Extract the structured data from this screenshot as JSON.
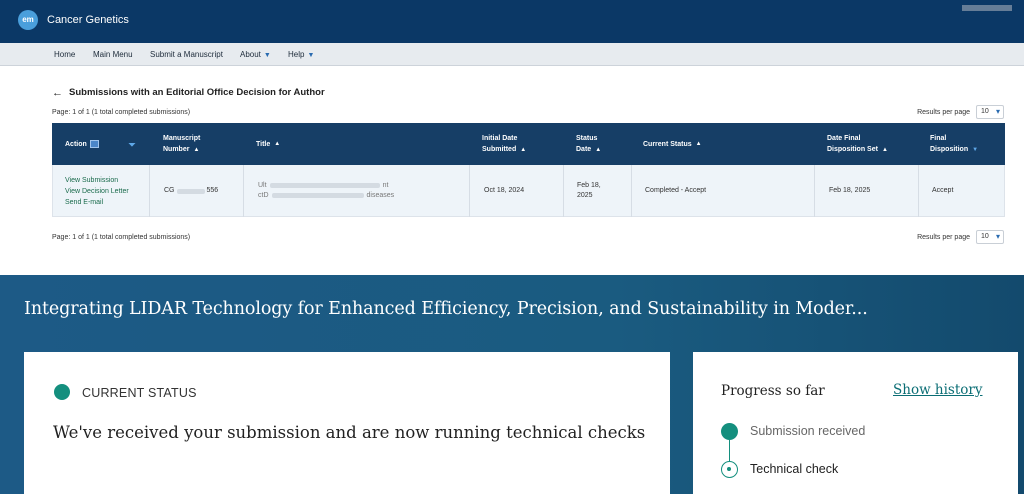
{
  "editorial_manager": {
    "logo_text": "em",
    "journal_name": "Cancer Genetics",
    "nav": [
      {
        "label": "Home",
        "dropdown": false
      },
      {
        "label": "Main Menu",
        "dropdown": false
      },
      {
        "label": "Submit a Manuscript",
        "dropdown": false
      },
      {
        "label": "About",
        "dropdown": true
      },
      {
        "label": "Help",
        "dropdown": true
      }
    ],
    "page_title": "Submissions with an Editorial Office Decision for Author",
    "paging_text": "Page: 1 of 1 (1 total completed submissions)",
    "results_per_page_label": "Results per page",
    "results_per_page_value": "10",
    "columns": {
      "action": "Action",
      "manuscript_number": [
        "Manuscript",
        "Number"
      ],
      "title": "Title",
      "initial_date": [
        "Initial Date",
        "Submitted"
      ],
      "status_date": [
        "Status",
        "Date"
      ],
      "current_status": "Current Status",
      "final_disposition_date": [
        "Date Final",
        "Disposition Set"
      ],
      "final_disposition": [
        "Final",
        "Disposition"
      ]
    },
    "row": {
      "actions": [
        "View Submission",
        "View Decision Letter",
        "Send E-mail"
      ],
      "manuscript_prefix": "CG",
      "manuscript_suffix": "556",
      "title_line1_start": "Ult",
      "title_line1_end": "nt",
      "title_line2_start": "ctD",
      "title_line2_end": "diseases",
      "initial_date": "Oct 18, 2024",
      "status_date": [
        "Feb 18,",
        "2025"
      ],
      "current_status": "Completed - Accept",
      "final_disposition_date": "Feb 18, 2025",
      "final_disposition": "Accept"
    },
    "accent_color": "#0b3866"
  },
  "springer_tracker": {
    "manuscript_title": "Integrating LIDAR Technology for Enhanced Efficiency, Precision, and Sustainability in Moder...",
    "status_label": "CURRENT STATUS",
    "status_message": "We've received your submission and are now running technical checks",
    "progress_title": "Progress so far",
    "show_history": "Show history",
    "steps": [
      {
        "label": "Submission received",
        "state": "complete"
      },
      {
        "label": "Technical check",
        "state": "current"
      }
    ],
    "accent_color": "#148f7e",
    "banner_color": "#1d5a86"
  }
}
